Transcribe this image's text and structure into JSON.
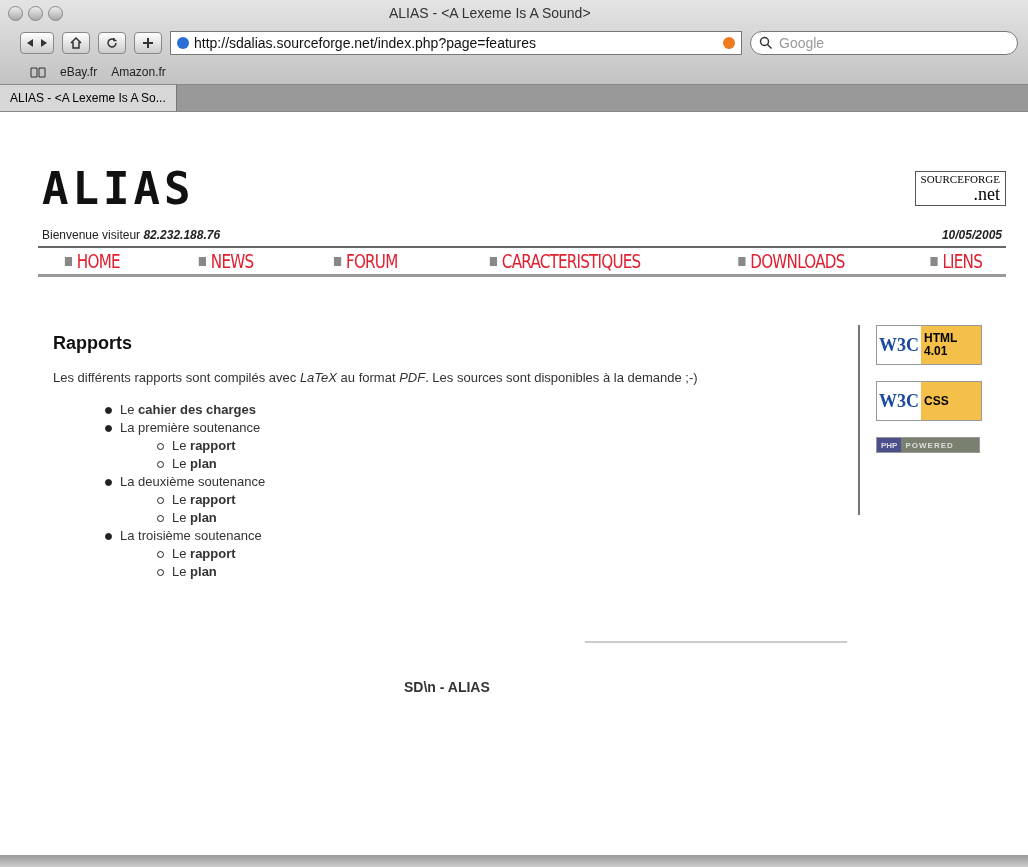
{
  "window": {
    "title": "ALIAS - <A Lexeme Is A Sound>"
  },
  "toolbar": {
    "url": "http://sdalias.sourceforge.net/index.php?page=features",
    "search_placeholder": "Google"
  },
  "bookmarks": [
    "eBay.fr",
    "Amazon.fr"
  ],
  "tabs": [
    {
      "label": "ALIAS - <A Lexeme Is A So...",
      "selected": true
    }
  ],
  "page": {
    "logo": "ALIAS",
    "sf_logo": {
      "top": "SOURCEFORGE",
      "bottom": ".net"
    },
    "welcome": "Bienvenue visiteur **82.232.188.76**",
    "date": "10/05/2005",
    "nav": [
      "HOME",
      "NEWS",
      "FORUM",
      "CARACTERISTIQUES",
      "DOWNLOADS",
      "LIENS"
    ],
    "heading": "Rapports",
    "intro": "Les différents rapports sont compilés avec *LaTeX* au format *PDF*. Les sources sont disponibles à la demande ;-)",
    "items": [
      {
        "text": "Le **cahier des charges**"
      },
      {
        "text": "La première soutenance",
        "children": [
          {
            "text": "Le **rapport**"
          },
          {
            "text": "Le **plan**"
          }
        ]
      },
      {
        "text": "La deuxième soutenance",
        "children": [
          {
            "text": "Le **rapport**"
          },
          {
            "text": "Le **plan**"
          }
        ]
      },
      {
        "text": "La troisième soutenance",
        "children": [
          {
            "text": "Le **rapport**"
          },
          {
            "text": "Le **plan**"
          }
        ]
      }
    ],
    "badges": [
      {
        "kind": "w3c",
        "org": "W3C",
        "label": "HTML 4.01"
      },
      {
        "kind": "w3c",
        "org": "W3C",
        "label": "CSS"
      },
      {
        "kind": "php",
        "org": "PHP",
        "label": "POWERED"
      }
    ],
    "footer": "SD\\n - ALIAS"
  }
}
